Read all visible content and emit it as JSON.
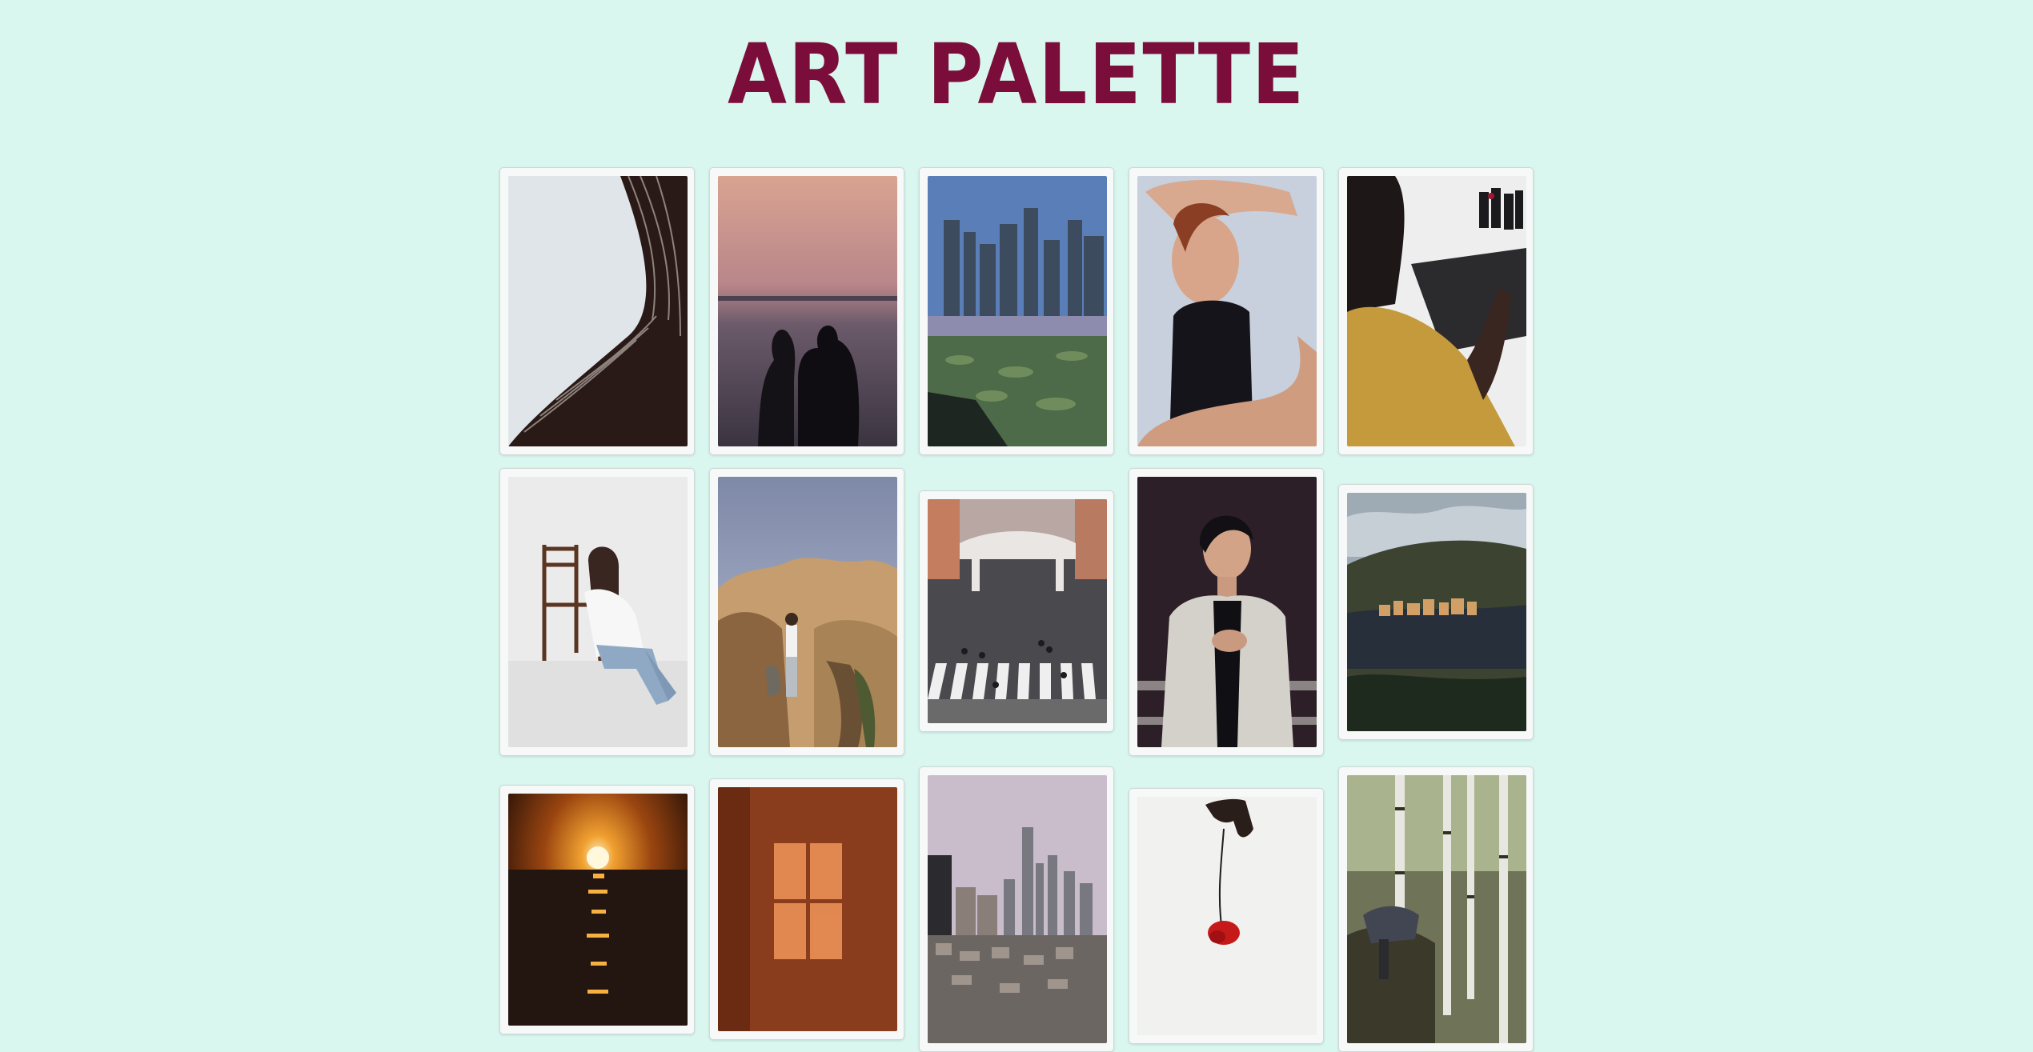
{
  "page": {
    "title": "ART PALETTE",
    "background": "#d9f7ef",
    "title_color": "#7b0d3a"
  },
  "gallery": {
    "images": [
      {
        "subject": "twisted-tower"
      },
      {
        "subject": "couple-sunset"
      },
      {
        "subject": "city-skyline-lilypads"
      },
      {
        "subject": "woman-portrait"
      },
      {
        "subject": "artist-painting"
      },
      {
        "subject": "woman-chair"
      },
      {
        "subject": "desert-rocks"
      },
      {
        "subject": "crosswalk-street"
      },
      {
        "subject": "man-portrait"
      },
      {
        "subject": "harbor-village"
      },
      {
        "subject": "sea-sunset"
      },
      {
        "subject": "window-light"
      },
      {
        "subject": "city-towers"
      },
      {
        "subject": "hand-red-flower"
      },
      {
        "subject": "birch-forest"
      }
    ]
  }
}
